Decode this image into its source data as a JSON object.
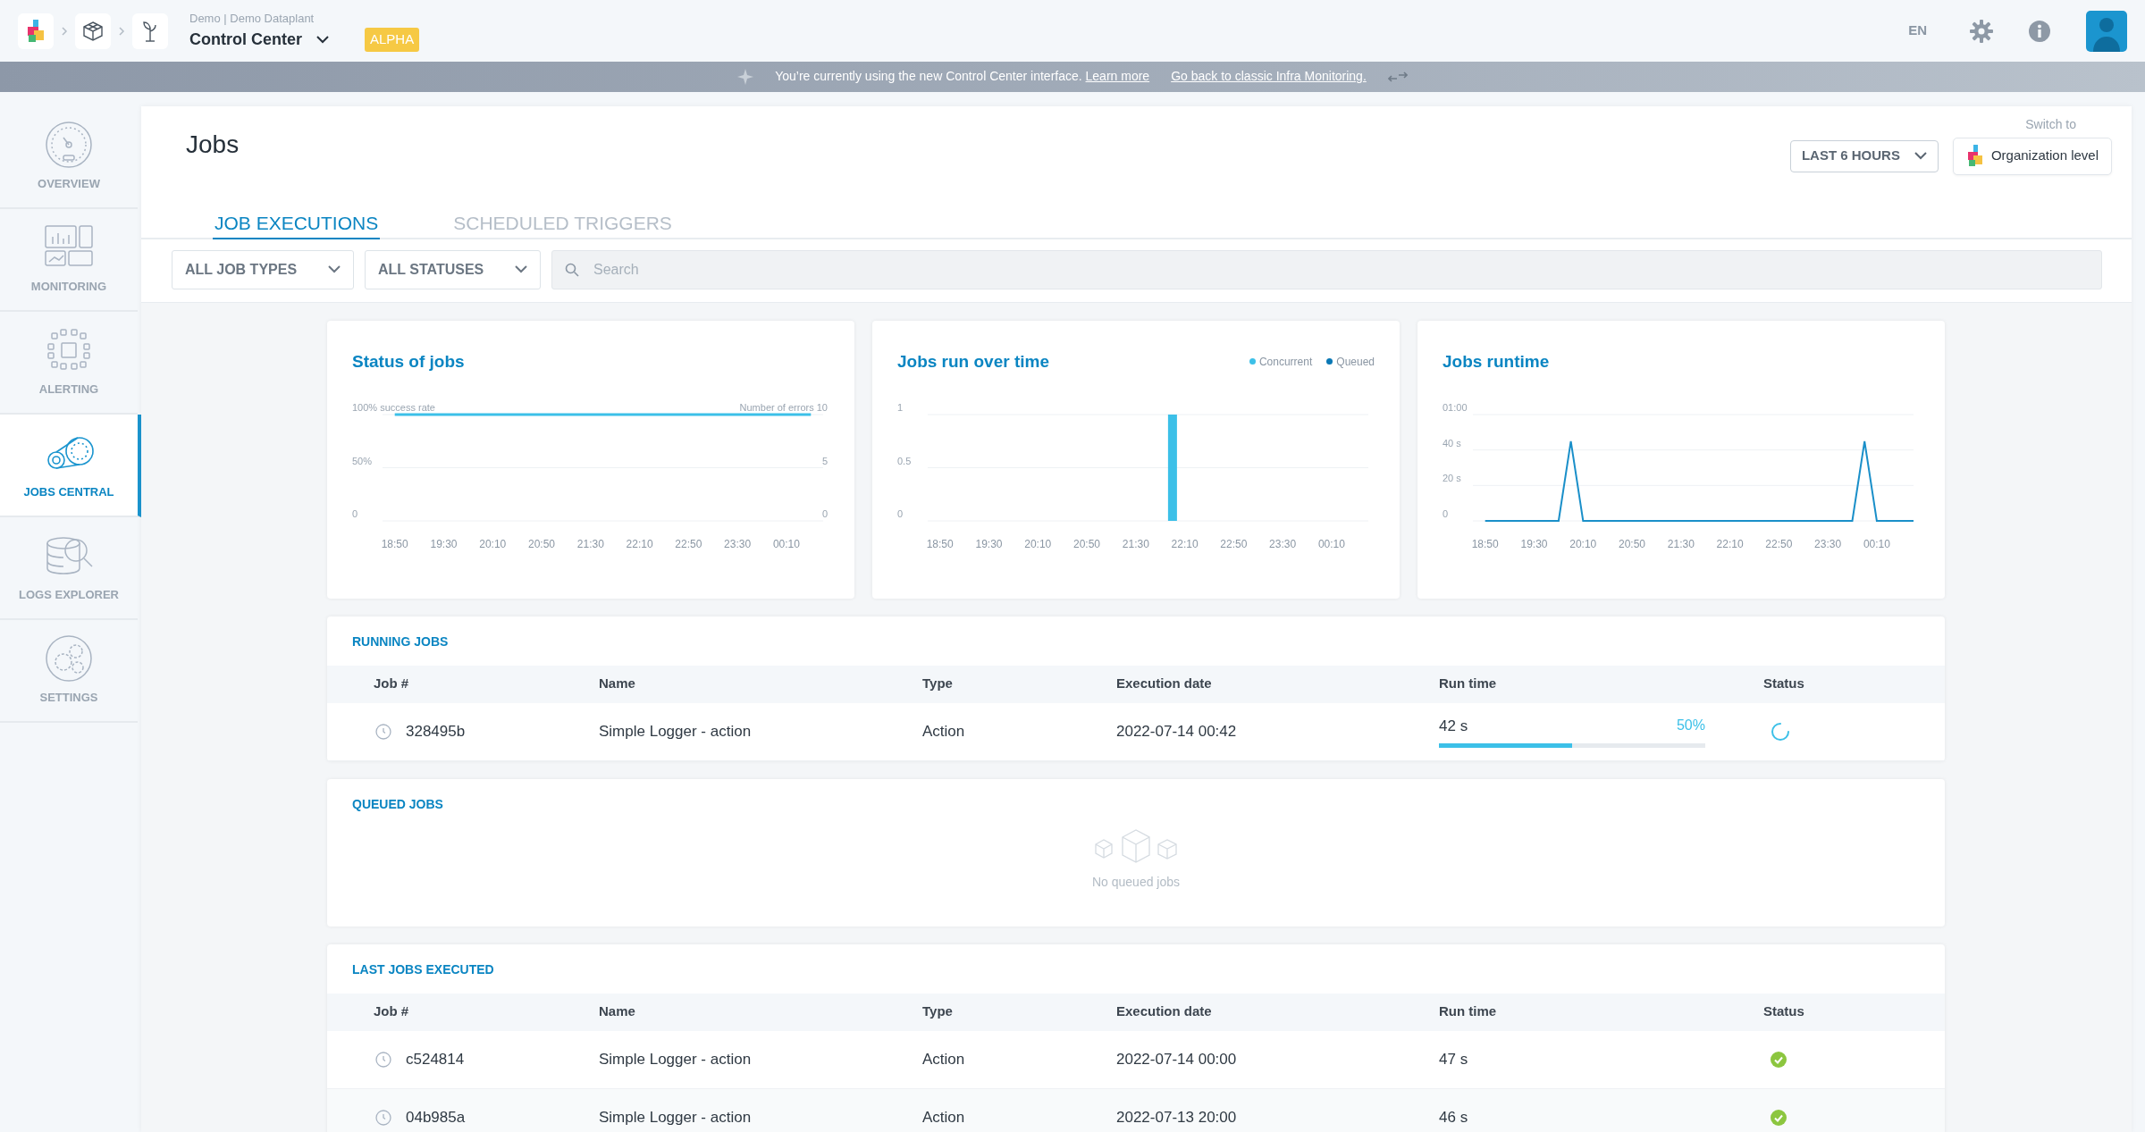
{
  "topbar": {
    "breadcrumb_parent": "Demo | Demo Dataplant",
    "title": "Control Center",
    "badge": "ALPHA",
    "language": "EN"
  },
  "banner": {
    "text": "You’re currently using the new Control Center interface.",
    "link": "Learn more",
    "link2": "Go back to classic Infra Monitoring."
  },
  "sidebar": {
    "items": [
      {
        "label": "OVERVIEW",
        "selected": false
      },
      {
        "label": "MONITORING",
        "selected": false
      },
      {
        "label": "ALERTING",
        "selected": false
      },
      {
        "label": "JOBS CENTRAL",
        "selected": true
      },
      {
        "label": "LOGS EXPLORER",
        "selected": false
      },
      {
        "label": "SETTINGS",
        "selected": false
      }
    ]
  },
  "page": {
    "title": "Jobs",
    "switch_label": "Switch to",
    "time_range": "LAST 6 HOURS",
    "level_button": "Organization level"
  },
  "tabs": [
    {
      "label": "JOB EXECUTIONS",
      "selected": true
    },
    {
      "label": "SCHEDULED TRIGGERS",
      "selected": false
    }
  ],
  "filters": {
    "job_types": "ALL JOB TYPES",
    "statuses": "ALL STATUSES",
    "search": {
      "placeholder": "Search"
    }
  },
  "charts": [
    {
      "chart_data": {
        "type": "line",
        "title": "Status of jobs",
        "ylim": [
          0,
          100
        ],
        "y2lim": [
          0,
          10
        ],
        "categories": [
          null,
          "18:50",
          null,
          null,
          null,
          "19:30",
          null,
          null,
          null,
          "20:10",
          null,
          null,
          null,
          "20:50",
          null,
          null,
          null,
          "21:30",
          null,
          null,
          null,
          "22:10",
          null,
          null,
          null,
          "22:50",
          null,
          null,
          null,
          "23:30",
          null,
          null,
          null,
          "00:10",
          null,
          null,
          null
        ],
        "yticks": [
          {
            "value": 0,
            "label": "0"
          },
          {
            "value": 50,
            "label": "50%"
          },
          {
            "value": 100,
            "label": "100% success rate"
          }
        ],
        "y2ticks": [
          {
            "value": 0,
            "label": "0"
          },
          {
            "value": 5,
            "label": "5"
          },
          {
            "value": 10,
            "label": "Number of errors 10"
          }
        ],
        "series": [
          {
            "color": "#3cc0e8",
            "values": [
              null,
              100,
              100,
              100,
              100,
              100,
              100,
              100,
              100,
              100,
              100,
              100,
              100,
              100,
              100,
              100,
              100,
              100,
              100,
              100,
              100,
              100,
              100,
              100,
              100,
              100,
              100,
              100,
              100,
              100,
              100,
              100,
              100,
              100,
              100,
              100,
              null
            ]
          }
        ]
      }
    },
    {
      "chart_data": {
        "type": "bar",
        "title": "Jobs run over time",
        "ylim": [
          0,
          1
        ],
        "categories": [
          null,
          "18:50",
          null,
          null,
          null,
          "19:30",
          null,
          null,
          null,
          "20:10",
          null,
          null,
          null,
          "20:50",
          null,
          null,
          null,
          "21:30",
          null,
          null,
          null,
          "22:10",
          null,
          null,
          null,
          "22:50",
          null,
          null,
          null,
          "23:30",
          null,
          null,
          null,
          "00:10",
          null,
          null,
          null
        ],
        "yticks": [
          {
            "value": 0,
            "label": "0"
          },
          {
            "value": 0.5,
            "label": "0.5"
          },
          {
            "value": 1,
            "label": "1"
          }
        ],
        "series": [
          {
            "name": "Concurrent",
            "color": "#3cc0e8",
            "values": [
              null,
              null,
              null,
              null,
              null,
              null,
              null,
              null,
              null,
              null,
              null,
              null,
              null,
              null,
              null,
              null,
              null,
              null,
              null,
              null,
              1,
              null,
              null,
              null,
              null,
              null,
              null,
              null,
              null,
              null,
              null,
              null,
              null,
              null,
              null,
              null,
              null
            ]
          },
          {
            "name": "Queued",
            "color": "#0a78b5",
            "values": [
              null,
              null,
              null,
              null,
              null,
              null,
              null,
              null,
              null,
              null,
              null,
              null,
              null,
              null,
              null,
              null,
              null,
              null,
              null,
              null,
              0,
              null,
              null,
              null,
              null,
              null,
              null,
              null,
              null,
              null,
              null,
              null,
              null,
              null,
              null,
              null,
              null
            ]
          }
        ]
      }
    },
    {
      "chart_data": {
        "type": "line",
        "title": "Jobs runtime",
        "ylim": [
          0,
          60
        ],
        "categories": [
          null,
          "18:50",
          null,
          null,
          null,
          "19:30",
          null,
          null,
          null,
          "20:10",
          null,
          null,
          null,
          "20:50",
          null,
          null,
          null,
          "21:30",
          null,
          null,
          null,
          "22:10",
          null,
          null,
          null,
          "22:50",
          null,
          null,
          null,
          "23:30",
          null,
          null,
          null,
          "00:10",
          null,
          null,
          null
        ],
        "yticks": [
          {
            "value": 0,
            "label": "0"
          },
          {
            "value": 20,
            "label": "20 s"
          },
          {
            "value": 40,
            "label": "40 s"
          },
          {
            "value": 60,
            "label": "01:00"
          }
        ],
        "series": [
          {
            "color": "#1a8fc9",
            "values": [
              null,
              0,
              0,
              0,
              0,
              0,
              0,
              0,
              45,
              0,
              0,
              0,
              0,
              0,
              0,
              0,
              0,
              0,
              0,
              0,
              0,
              0,
              0,
              0,
              0,
              0,
              0,
              0,
              0,
              0,
              0,
              0,
              45,
              0,
              0,
              0,
              0
            ]
          }
        ]
      }
    }
  ],
  "running_jobs": {
    "title": "RUNNING JOBS",
    "columns": [
      "Job #",
      "Name",
      "Type",
      "Execution date",
      "Run time",
      "Status"
    ],
    "rows": [
      {
        "job": "328495b",
        "name": "Simple Logger - action",
        "type": "Action",
        "date": "2022-07-14 00:42",
        "run_time": "42 s",
        "percent": "50%",
        "level": 0.5,
        "kind": "running"
      }
    ]
  },
  "queued_jobs": {
    "title": "QUEUED JOBS",
    "empty_text": "No queued jobs"
  },
  "last_jobs": {
    "title": "LAST JOBS EXECUTED",
    "columns": [
      "Job #",
      "Name",
      "Type",
      "Execution date",
      "Run time",
      "Status"
    ],
    "rows": [
      {
        "job": "c524814",
        "name": "Simple Logger - action",
        "type": "Action",
        "date": "2022-07-14 00:00",
        "run_time": "47 s",
        "kind": "success"
      },
      {
        "job": "04b985a",
        "name": "Simple Logger - action",
        "type": "Action",
        "date": "2022-07-13 20:00",
        "run_time": "46 s",
        "kind": "success"
      }
    ]
  }
}
